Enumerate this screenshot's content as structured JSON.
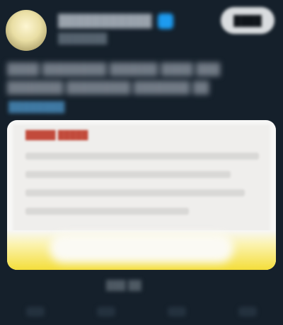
{
  "header": {
    "display_name": "███████████",
    "handle": "███████",
    "follow_label": "████"
  },
  "tweet": {
    "text": "████ ████████ ██████ ████ ███ ███████ ████████ ███████ ██",
    "link": "████████"
  },
  "media": {
    "title": "█████ █████"
  },
  "footer": {
    "timestamp": "███ ██"
  },
  "colors": {
    "background": "#15202b",
    "verified": "#1d9bf0",
    "card_yellow": "#f4de3a"
  }
}
